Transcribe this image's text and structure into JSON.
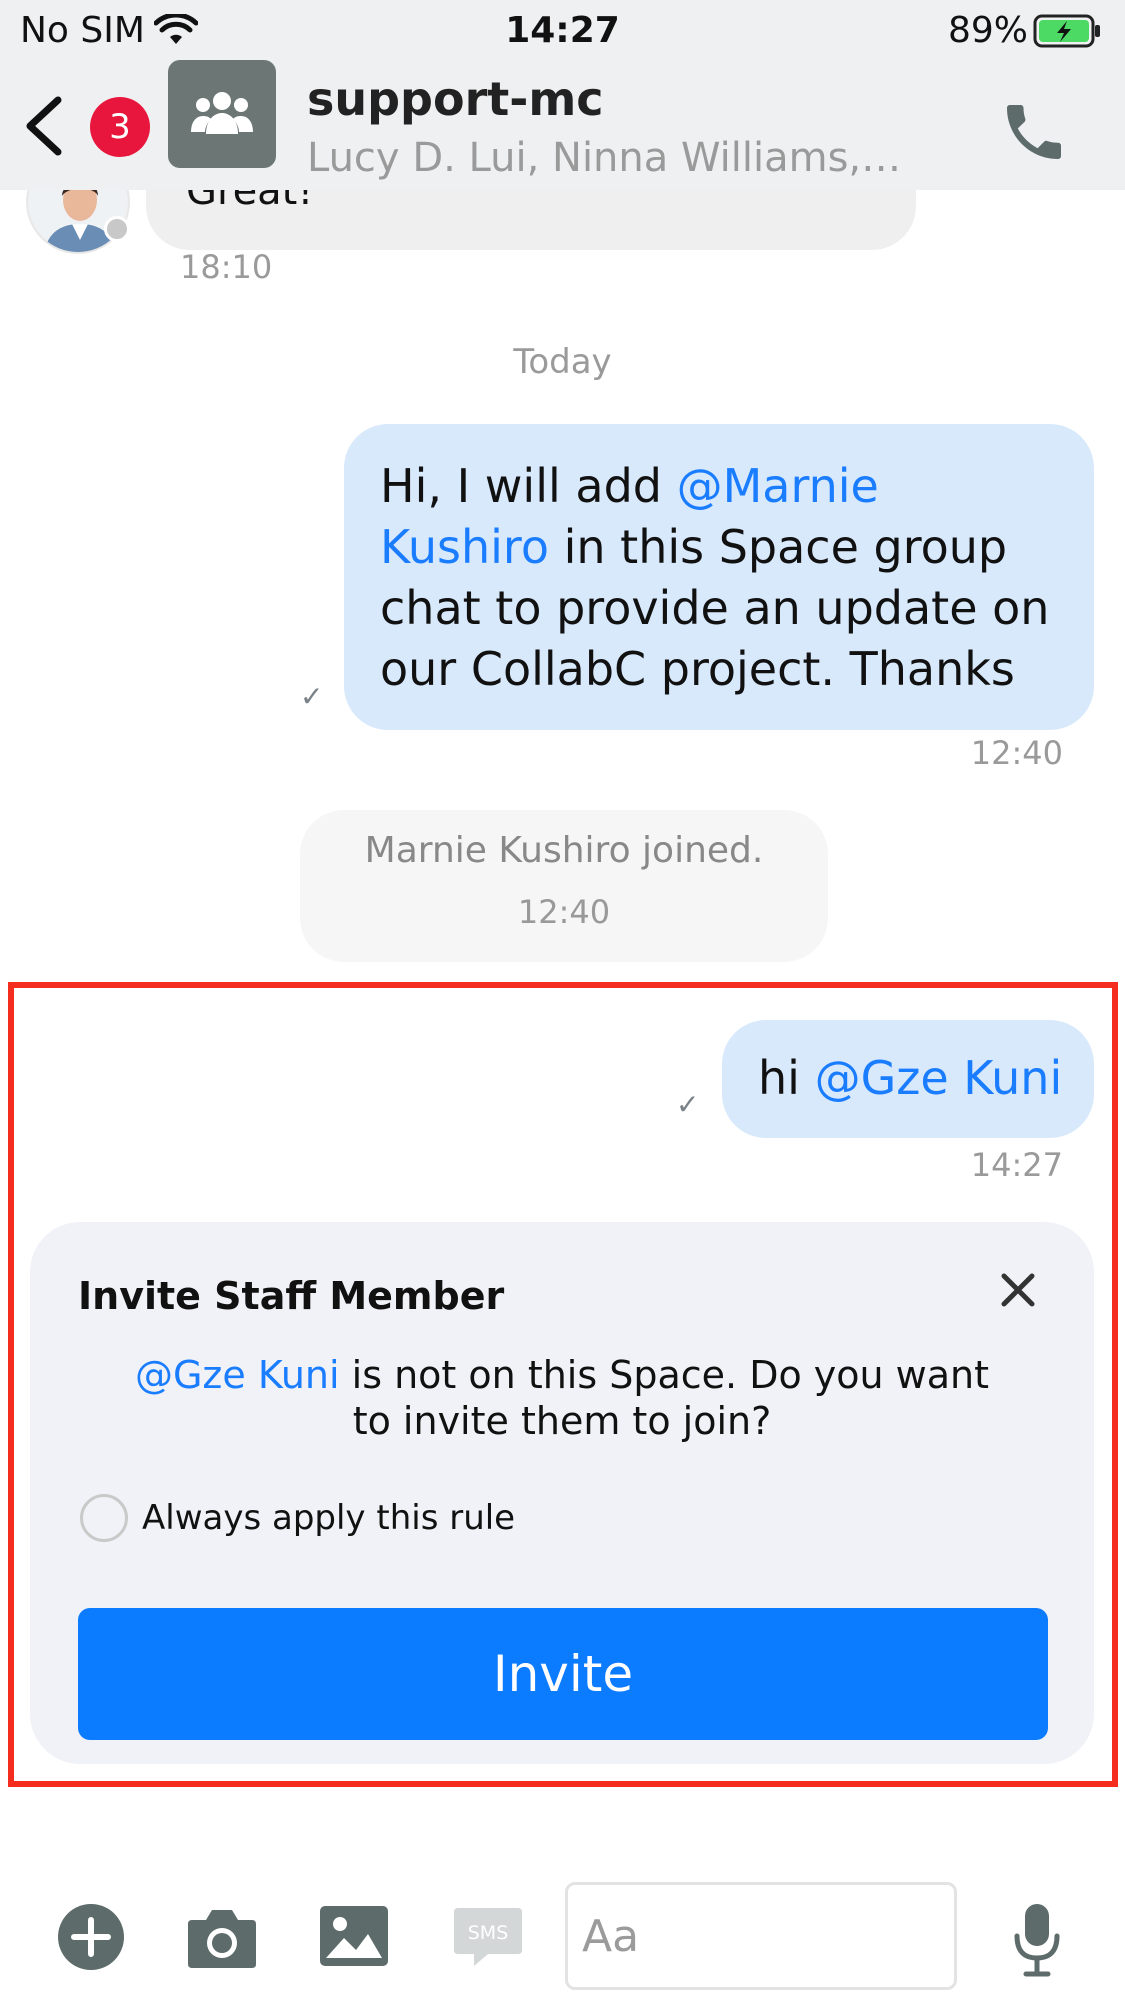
{
  "status_bar": {
    "carrier": "No SIM",
    "time": "14:27",
    "battery": "89%"
  },
  "header": {
    "unread_badge": "3",
    "title": "support-mc",
    "subtitle": "Lucy D. Lui, Ninna Williams,…"
  },
  "chat": {
    "previous_message": {
      "text": "Great!",
      "time": "18:10"
    },
    "date_separator": "Today",
    "message_1": {
      "prefix": "Hi, I will add ",
      "mention": "@Marnie Kushiro",
      "suffix": " in this Space group chat to provide an update on our CollabC project. Thanks",
      "time": "12:40",
      "status_icon": "✓"
    },
    "system_event": {
      "text": "Marnie Kushiro joined.",
      "time": "12:40"
    },
    "message_2": {
      "prefix": "hi ",
      "mention": "@Gze Kuni",
      "time": "14:27",
      "status_icon": "✓"
    }
  },
  "invite_prompt": {
    "title": "Invite Staff Member",
    "mention": "@Gze Kuni",
    "message": " is not on this Space. Do you want to invite them to join?",
    "checkbox_label": "Always apply this rule",
    "button_label": "Invite"
  },
  "composer": {
    "placeholder": "Aa",
    "sms_label": "SMS"
  },
  "colors": {
    "accent": "#0b7cff",
    "mention": "#1a7cff",
    "badge": "#e8163c",
    "highlight_border": "#f42d1e",
    "outgoing_bubble": "#d8e9fc"
  }
}
